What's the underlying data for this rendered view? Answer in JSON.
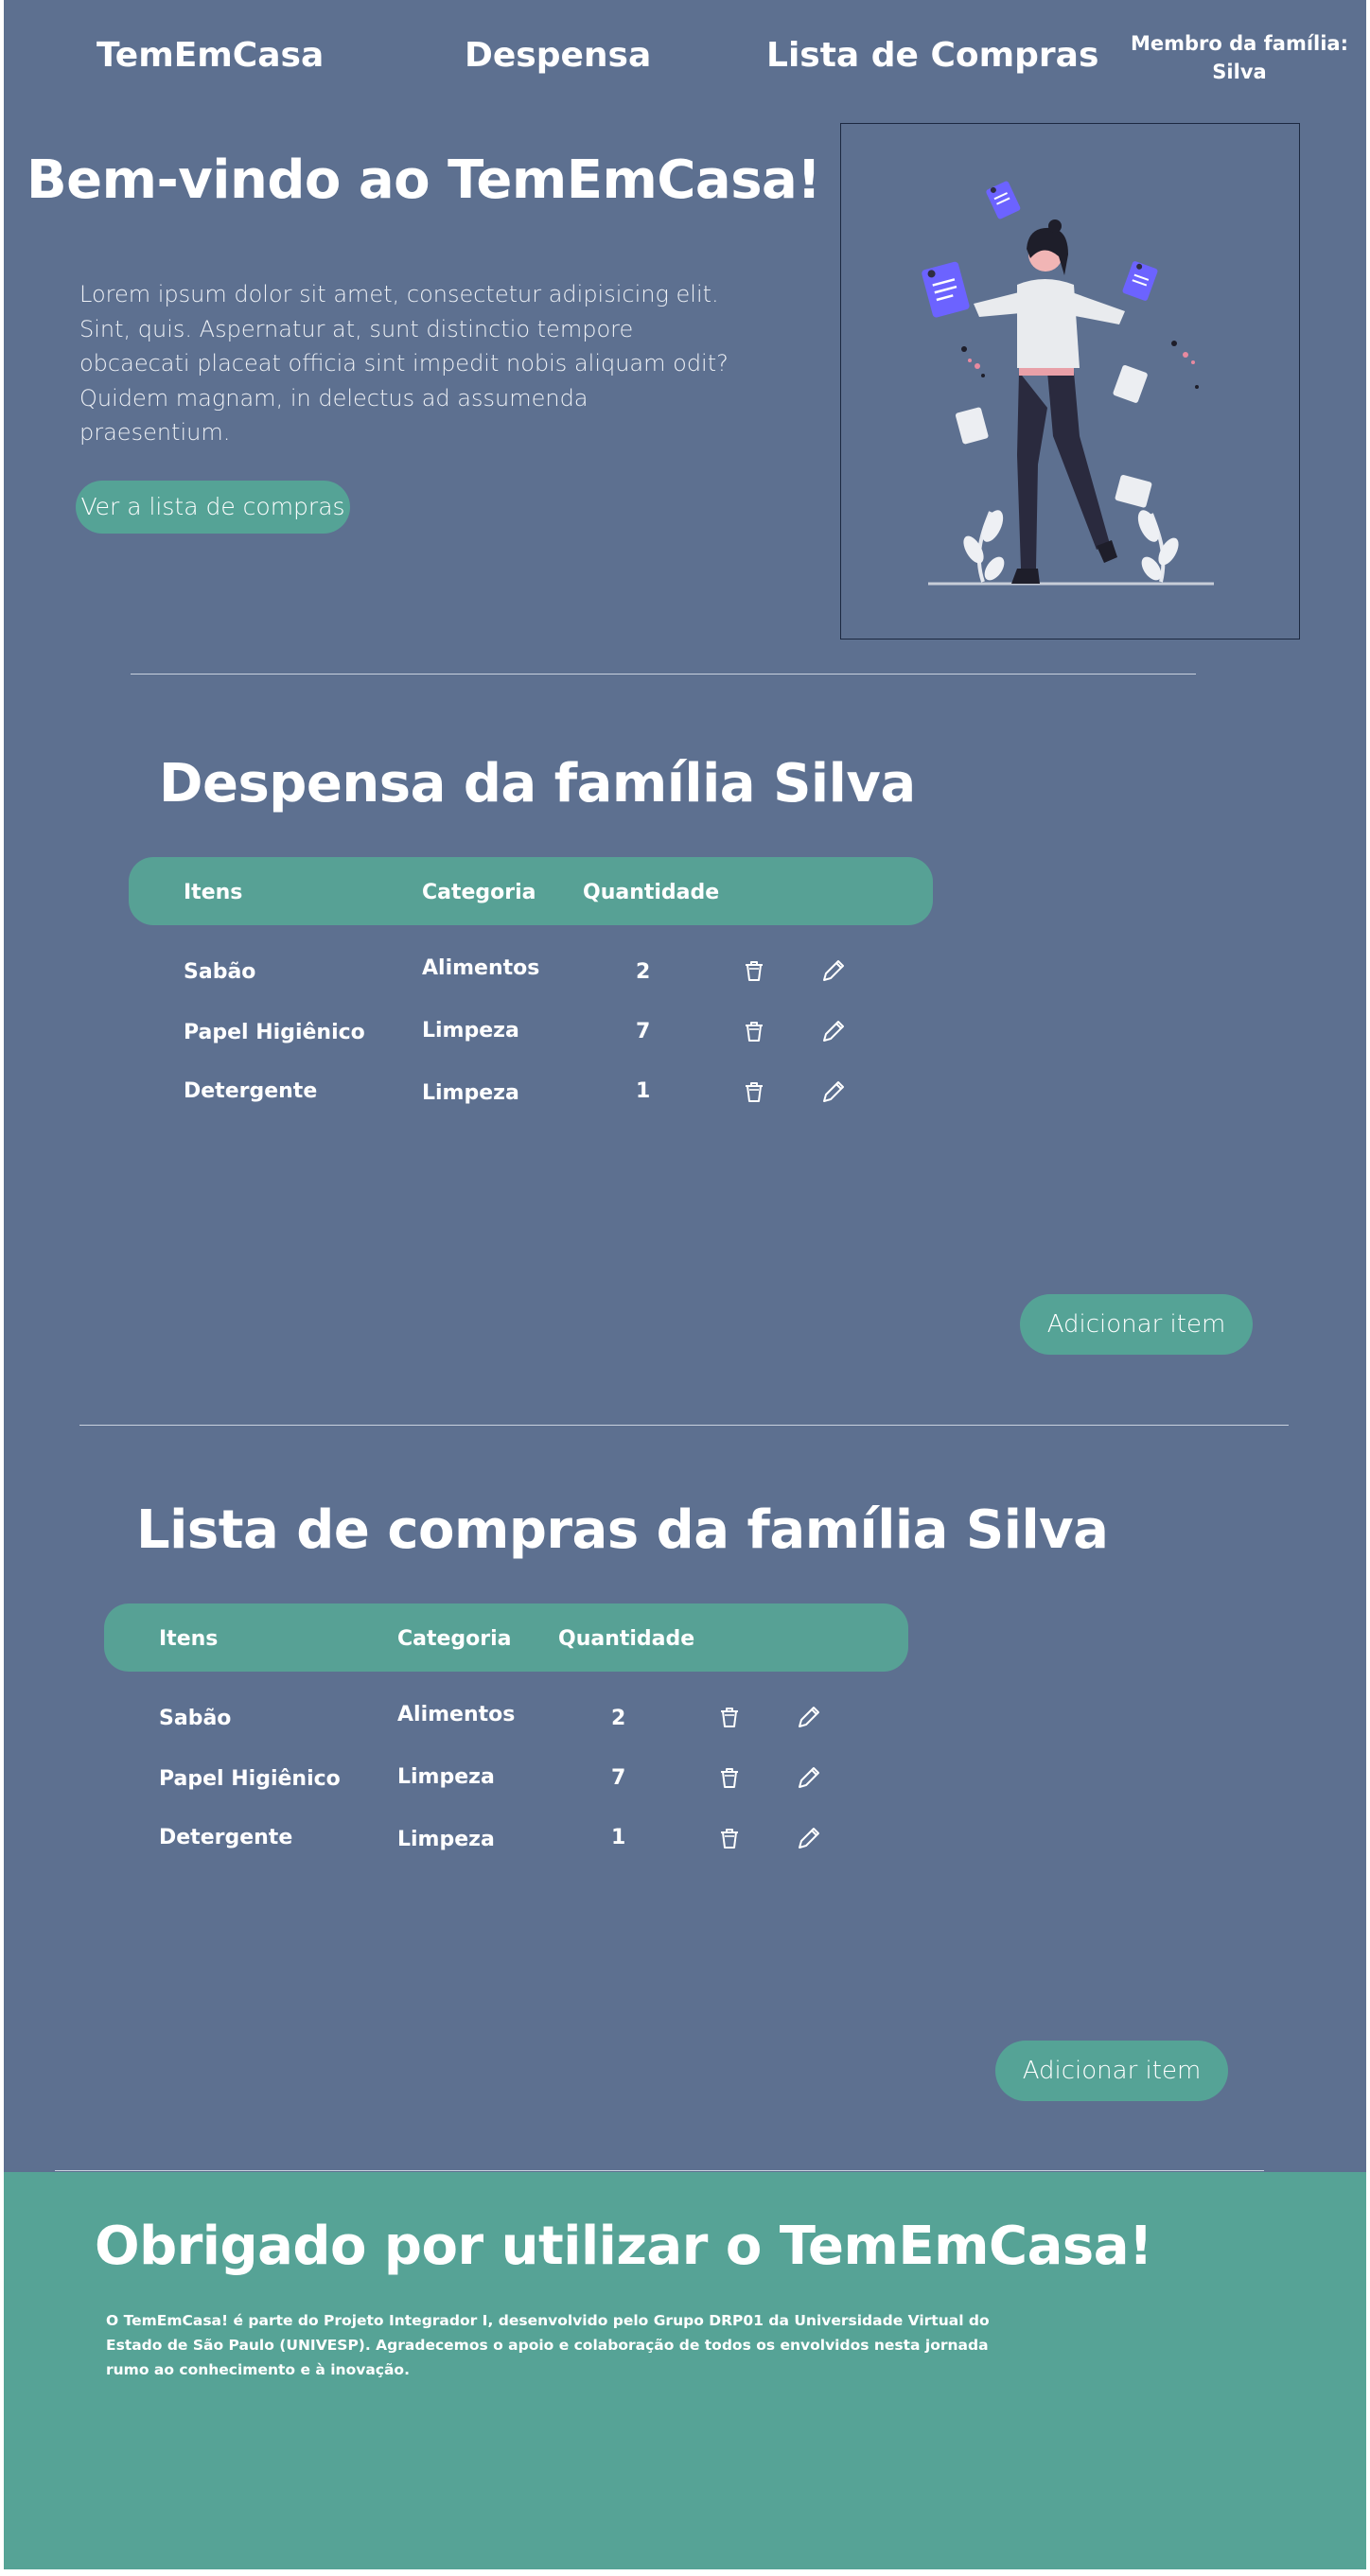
{
  "header": {
    "brand": "TemEmCasa",
    "nav": [
      "Despensa",
      "Lista de Compras"
    ],
    "member_label": "Membro da família:",
    "member_name": "Silva"
  },
  "hero": {
    "title": "Bem-vindo ao TemEmCasa!",
    "text": "Lorem ipsum dolor sit amet, consectetur adipisicing elit. Sint, quis. Aspernatur at, sunt distinctio tempore obcaecati placeat officia sint impedit nobis aliquam odit? Quidem magnam, in delectus ad assumenda praesentium.",
    "button": "Ver a lista de compras"
  },
  "pantry": {
    "title": "Despensa da família Silva",
    "columns": [
      "Itens",
      "Categoria",
      "Quantidade"
    ],
    "rows": [
      {
        "item": "Sabão",
        "category": "Alimentos",
        "qty": "2"
      },
      {
        "item": "Papel Higiênico",
        "category": "Limpeza",
        "qty": "7"
      },
      {
        "item": "Detergente",
        "category": "Limpeza",
        "qty": "1"
      }
    ],
    "add_button": "Adicionar item"
  },
  "shopping": {
    "title": "Lista de compras da família Silva",
    "columns": [
      "Itens",
      "Categoria",
      "Quantidade"
    ],
    "rows": [
      {
        "item": "Sabão",
        "category": "Alimentos",
        "qty": "2"
      },
      {
        "item": "Papel Higiênico",
        "category": "Limpeza",
        "qty": "7"
      },
      {
        "item": "Detergente",
        "category": "Limpeza",
        "qty": "1"
      }
    ],
    "add_button": "Adicionar item"
  },
  "footer": {
    "title": "Obrigado por utilizar o TemEmCasa!",
    "text": "O TemEmCasa! é parte do Projeto Integrador I, desenvolvido pelo Grupo DRP01 da Universidade Virtual do Estado de São Paulo (UNIVESP). Agradecemos o apoio e colaboração de todos os envolvidos nesta jornada rumo ao conhecimento e à inovação."
  },
  "icons": {
    "row_actions": [
      "trash-icon",
      "pencil-icon"
    ]
  },
  "colors": {
    "background": "#5d7090",
    "accent": "#56a396",
    "text": "#ffffff"
  }
}
